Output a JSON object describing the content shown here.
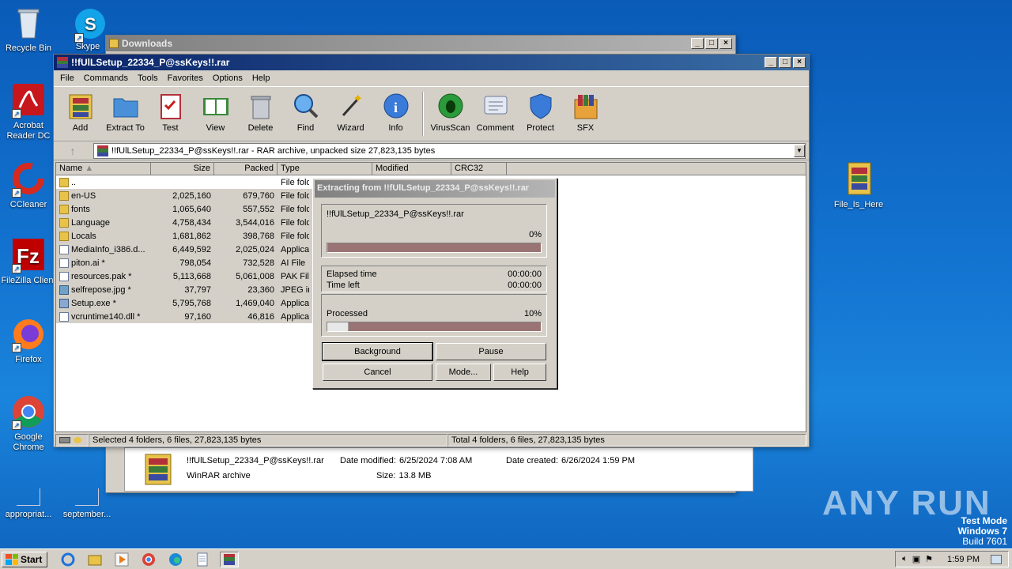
{
  "desktop": {
    "icons": [
      {
        "label": "Recycle Bin"
      },
      {
        "label": "Skype"
      },
      {
        "label": "Acrobat Reader DC"
      },
      {
        "label": "CCleaner"
      },
      {
        "label": "FileZilla Client"
      },
      {
        "label": "Firefox"
      },
      {
        "label": "Google Chrome"
      },
      {
        "label": "appropriat..."
      },
      {
        "label": "september..."
      },
      {
        "label": "File_Is_Here"
      }
    ],
    "watermark": {
      "line1": "Test Mode",
      "line2": "Windows 7",
      "line3": "Build 7601"
    },
    "anyrun_logo": "ANY RUN"
  },
  "downloads_window": {
    "title": "Downloads",
    "details": {
      "filename": "!!fUlLSetup_22334_P@ssKeys!!.rar",
      "filetype": "WinRAR archive",
      "date_modified_label": "Date modified:",
      "date_modified": "6/25/2024 7:08 AM",
      "date_created_label": "Date created:",
      "date_created": "6/26/2024 1:59 PM",
      "size_label": "Size:",
      "size": "13.8 MB"
    }
  },
  "winrar": {
    "title": "!!fUlLSetup_22334_P@ssKeys!!.rar",
    "menu": [
      "File",
      "Commands",
      "Tools",
      "Favorites",
      "Options",
      "Help"
    ],
    "toolbar": [
      "Add",
      "Extract To",
      "Test",
      "View",
      "Delete",
      "Find",
      "Wizard",
      "Info",
      "VirusScan",
      "Comment",
      "Protect",
      "SFX"
    ],
    "address": "!!fUlLSetup_22334_P@ssKeys!!.rar - RAR archive, unpacked size 27,823,135 bytes",
    "columns": [
      "Name",
      "Size",
      "Packed",
      "Type",
      "Modified",
      "CRC32"
    ],
    "rows": [
      {
        "name": "..",
        "size": "",
        "packed": "",
        "type": "File fold",
        "icon": "folder"
      },
      {
        "name": "en-US",
        "size": "2,025,160",
        "packed": "679,760",
        "type": "File fold",
        "icon": "folder"
      },
      {
        "name": "fonts",
        "size": "1,065,640",
        "packed": "557,552",
        "type": "File fold",
        "icon": "folder"
      },
      {
        "name": "Language",
        "size": "4,758,434",
        "packed": "3,544,016",
        "type": "File fold",
        "icon": "folder"
      },
      {
        "name": "Locals",
        "size": "1,681,862",
        "packed": "398,768",
        "type": "File fold",
        "icon": "folder"
      },
      {
        "name": "MediaInfo_i386.d...",
        "size": "6,449,592",
        "packed": "2,025,024",
        "type": "Applicat",
        "icon": "file"
      },
      {
        "name": "piton.ai *",
        "size": "798,054",
        "packed": "732,528",
        "type": "AI File",
        "icon": "file"
      },
      {
        "name": "resources.pak *",
        "size": "5,113,668",
        "packed": "5,061,008",
        "type": "PAK File",
        "icon": "file"
      },
      {
        "name": "selfrepose.jpg *",
        "size": "37,797",
        "packed": "23,360",
        "type": "JPEG im",
        "icon": "img"
      },
      {
        "name": "Setup.exe *",
        "size": "5,795,768",
        "packed": "1,469,040",
        "type": "Applicat",
        "icon": "exe"
      },
      {
        "name": "vcruntime140.dll *",
        "size": "97,160",
        "packed": "46,816",
        "type": "Applicat",
        "icon": "file"
      }
    ],
    "status_left": "Selected 4 folders, 6 files, 27,823,135 bytes",
    "status_right": "Total 4 folders, 6 files, 27,823,135 bytes"
  },
  "extract_dialog": {
    "title": "Extracting from !!fUlLSetup_22334_P@ssKeys!!.rar",
    "current_file": "!!fUlLSetup_22334_P@ssKeys!!.rar",
    "file_percent": "0%",
    "file_progress": 0,
    "elapsed_label": "Elapsed time",
    "elapsed": "00:00:00",
    "left_label": "Time left",
    "left": "00:00:00",
    "processed_label": "Processed",
    "processed_percent": "10%",
    "processed_progress": 0.1,
    "buttons": {
      "background": "Background",
      "pause": "Pause",
      "cancel": "Cancel",
      "mode": "Mode...",
      "help": "Help"
    }
  },
  "taskbar": {
    "start": "Start",
    "clock": "1:59 PM"
  }
}
